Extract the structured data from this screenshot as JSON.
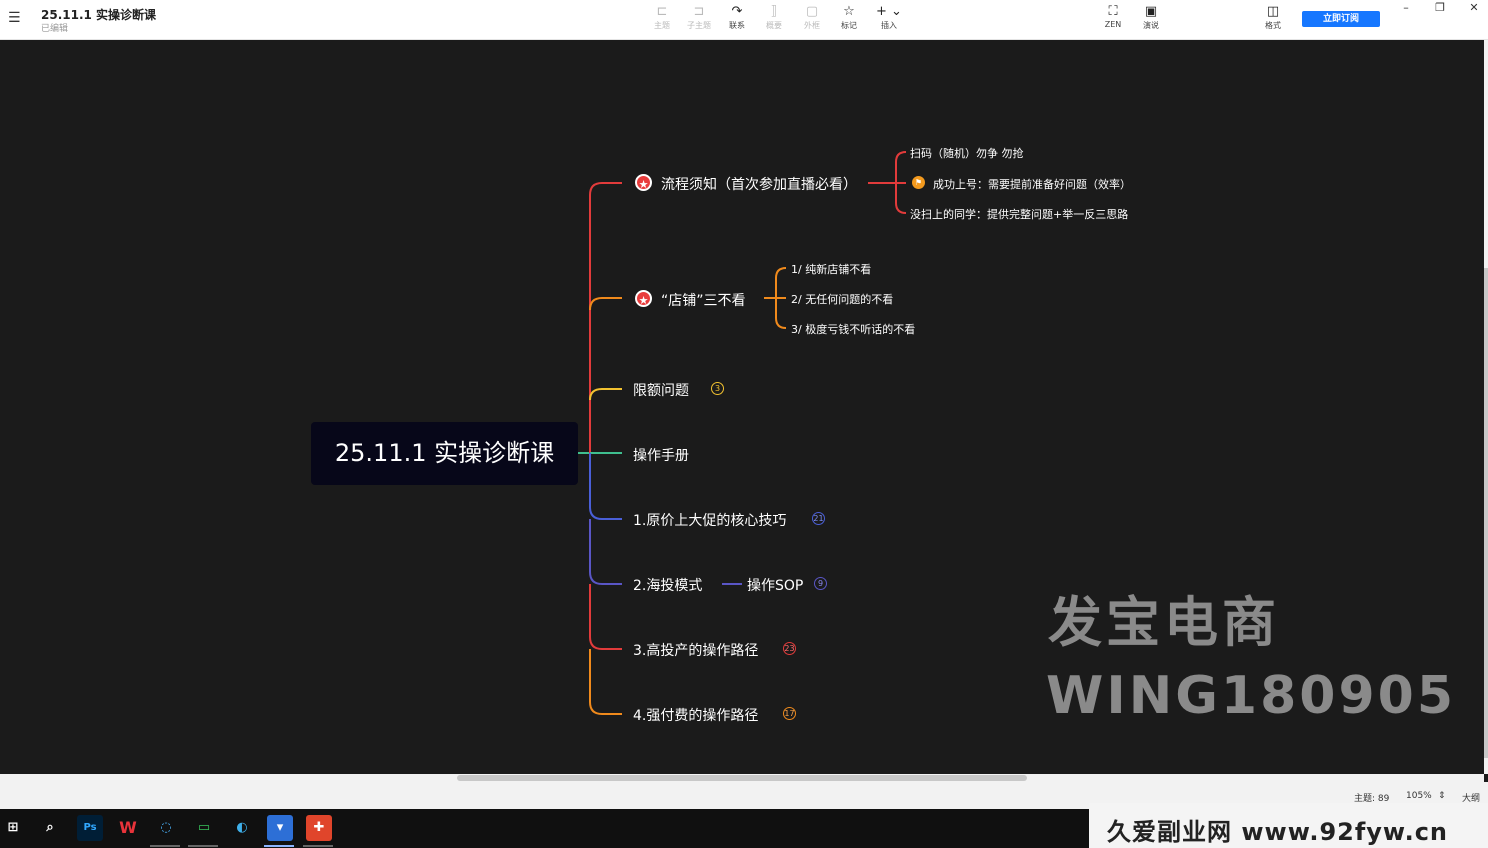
{
  "titlebar": {
    "doc_title": "25.11.1 实操诊断课",
    "doc_status": "已编辑",
    "tools": {
      "topic": "主题",
      "subtopic": "子主题",
      "relation": "联系",
      "summary": "概要",
      "boundary": "外框",
      "marker": "标记",
      "insert": "插入",
      "zen": "ZEN",
      "present": "演说",
      "format": "格式"
    },
    "subscribe": "立即订阅"
  },
  "mindmap": {
    "root": "25.11.1 实操诊断课",
    "branches": [
      {
        "label": "流程须知（首次参加直播必看）",
        "color": "#e23b3b",
        "children": [
          "扫码（随机）勿争 勿抢",
          "成功上号：需要提前准备好问题（效率）",
          "没扫上的同学：提供完整问题+举一反三思路"
        ]
      },
      {
        "label": "“店铺”三不看",
        "color": "#f08a1c",
        "children": [
          "1/ 纯新店铺不看",
          "2/ 无任何问题的不看",
          "3/ 极度亏钱不听话的不看"
        ]
      },
      {
        "label": "限额问题",
        "color": "#f2c230",
        "count": "3"
      },
      {
        "label": "操作手册",
        "color": "#3fbf8f"
      },
      {
        "label": "1.原价上大促的核心技巧",
        "color": "#4a5fd8",
        "count": "21"
      },
      {
        "label": "2.海投模式",
        "color": "#5a56c6",
        "child": "操作SOP",
        "count": "9"
      },
      {
        "label": "3.高投产的操作路径",
        "color": "#e23b3b",
        "count": "23"
      },
      {
        "label": "4.强付费的操作路径",
        "color": "#f08a1c",
        "count": "17"
      }
    ]
  },
  "watermark": {
    "line1": "发宝电商",
    "line2": "WING180905",
    "footer": "久爱副业网  www.92fyw.cn"
  },
  "statusbar": {
    "topic_count": "主题: 89",
    "zoom": "105%",
    "outline": "大纲"
  },
  "taskbar": {
    "apps": [
      "start-icon",
      "search-icon",
      "photoshop-icon",
      "wps-icon",
      "browser-icon",
      "chat-icon",
      "edge-icon",
      "xmind-icon",
      "app-icon"
    ],
    "ps_label": "Ps",
    "wps_label": "W"
  }
}
